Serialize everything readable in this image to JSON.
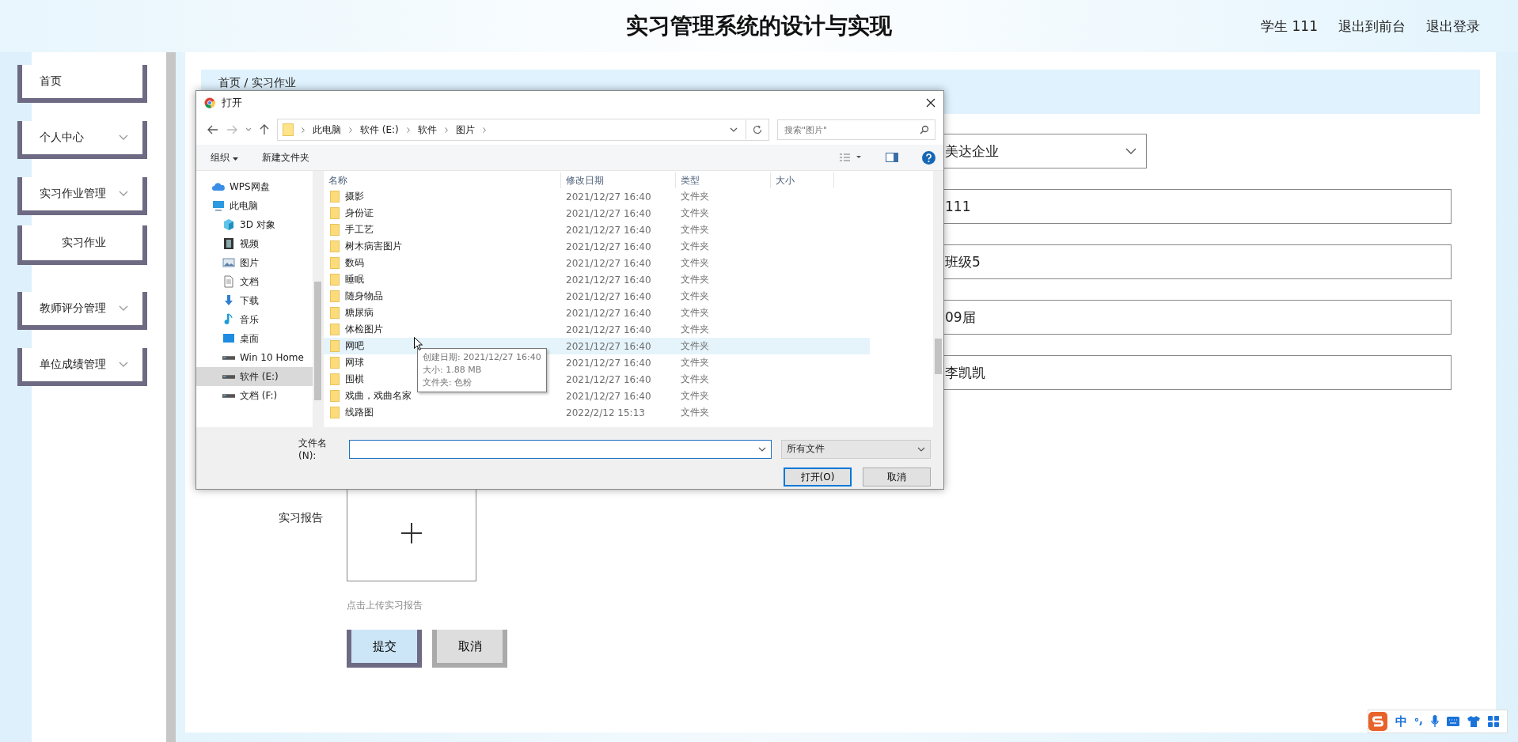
{
  "header": {
    "title": "实习管理系统的设计与实现",
    "user": "学生 111",
    "links": [
      "退出到前台",
      "退出登录"
    ]
  },
  "sidebar": {
    "items": [
      {
        "label": "首页",
        "kind": "link"
      },
      {
        "label": "个人中心",
        "kind": "group"
      },
      {
        "label": "实习作业管理",
        "kind": "group",
        "children": [
          {
            "label": "实习作业"
          }
        ]
      },
      {
        "label": "教师评分管理",
        "kind": "group"
      },
      {
        "label": "单位成绩管理",
        "kind": "group"
      }
    ]
  },
  "breadcrumb": "首页 / 实习作业",
  "form": {
    "company_select": "美达企业",
    "fields": [
      "111",
      "班级5",
      "09届",
      "李凯凯"
    ],
    "upload": {
      "label": "实习报告",
      "hint": "点击上传实习报告"
    },
    "buttons": [
      {
        "label": "提交",
        "kind": "primary"
      },
      {
        "label": "取消",
        "kind": "secondary"
      }
    ]
  },
  "dialog": {
    "title": "打开",
    "address": [
      "此电脑",
      "软件 (E:)",
      "软件",
      "图片"
    ],
    "search": {
      "placeholder": "搜索\"图片\""
    },
    "toolbar": {
      "organize": "组织",
      "new_folder": "新建文件夹"
    },
    "nav": [
      {
        "label": "WPS网盘",
        "kind": "cloud",
        "selected": false
      },
      {
        "label": "此电脑",
        "kind": "computer",
        "selected": false,
        "children": [
          {
            "label": "3D 对象",
            "kind": "cube",
            "selected": false
          },
          {
            "label": "视频",
            "kind": "film",
            "selected": false
          },
          {
            "label": "图片",
            "kind": "picture",
            "selected": false
          },
          {
            "label": "文档",
            "kind": "document",
            "selected": false
          },
          {
            "label": "下载",
            "kind": "download",
            "selected": false
          },
          {
            "label": "音乐",
            "kind": "music",
            "selected": false
          },
          {
            "label": "桌面",
            "kind": "desktop",
            "selected": false
          },
          {
            "label": "Win 10 Home",
            "kind": "drive",
            "selected": false
          },
          {
            "label": "软件 (E:)",
            "kind": "drive",
            "selected": true
          },
          {
            "label": "文档 (F:)",
            "kind": "drive",
            "selected": false
          }
        ]
      }
    ],
    "columns": [
      "名称",
      "修改日期",
      "类型",
      "大小"
    ],
    "rows": [
      {
        "name": "摄影",
        "date": "2021/12/27 16:40",
        "type": "文件夹",
        "hovered": false
      },
      {
        "name": "身份证",
        "date": "2021/12/27 16:40",
        "type": "文件夹",
        "hovered": false
      },
      {
        "name": "手工艺",
        "date": "2021/12/27 16:40",
        "type": "文件夹",
        "hovered": false
      },
      {
        "name": "树木病害图片",
        "date": "2021/12/27 16:40",
        "type": "文件夹",
        "hovered": false
      },
      {
        "name": "数码",
        "date": "2021/12/27 16:40",
        "type": "文件夹",
        "hovered": false
      },
      {
        "name": "睡眠",
        "date": "2021/12/27 16:40",
        "type": "文件夹",
        "hovered": false
      },
      {
        "name": "随身物品",
        "date": "2021/12/27 16:40",
        "type": "文件夹",
        "hovered": false
      },
      {
        "name": "糖尿病",
        "date": "2021/12/27 16:40",
        "type": "文件夹",
        "hovered": false
      },
      {
        "name": "体检图片",
        "date": "2021/12/27 16:40",
        "type": "文件夹",
        "hovered": false
      },
      {
        "name": "网吧",
        "date": "2021/12/27 16:40",
        "type": "文件夹",
        "hovered": true
      },
      {
        "name": "网球",
        "date": "2021/12/27 16:40",
        "type": "文件夹",
        "hovered": false
      },
      {
        "name": "围棋",
        "date": "2021/12/27 16:40",
        "type": "文件夹",
        "hovered": false
      },
      {
        "name": "戏曲，戏曲名家",
        "date": "2021/12/27 16:40",
        "type": "文件夹",
        "hovered": false
      },
      {
        "name": "线路图",
        "date": "2022/2/12 15:13",
        "type": "文件夹",
        "hovered": false
      }
    ],
    "tooltip": [
      "创建日期: 2021/12/27 16:40",
      "大小: 1.88 MB",
      "文件夹: 色粉"
    ],
    "filename_label": "文件名(N):",
    "filter": "所有文件",
    "buttons": [
      {
        "label": "打开(O)",
        "kind": "primary"
      },
      {
        "label": "取消",
        "kind": "secondary"
      }
    ]
  },
  "ime": {
    "mode": "中"
  }
}
